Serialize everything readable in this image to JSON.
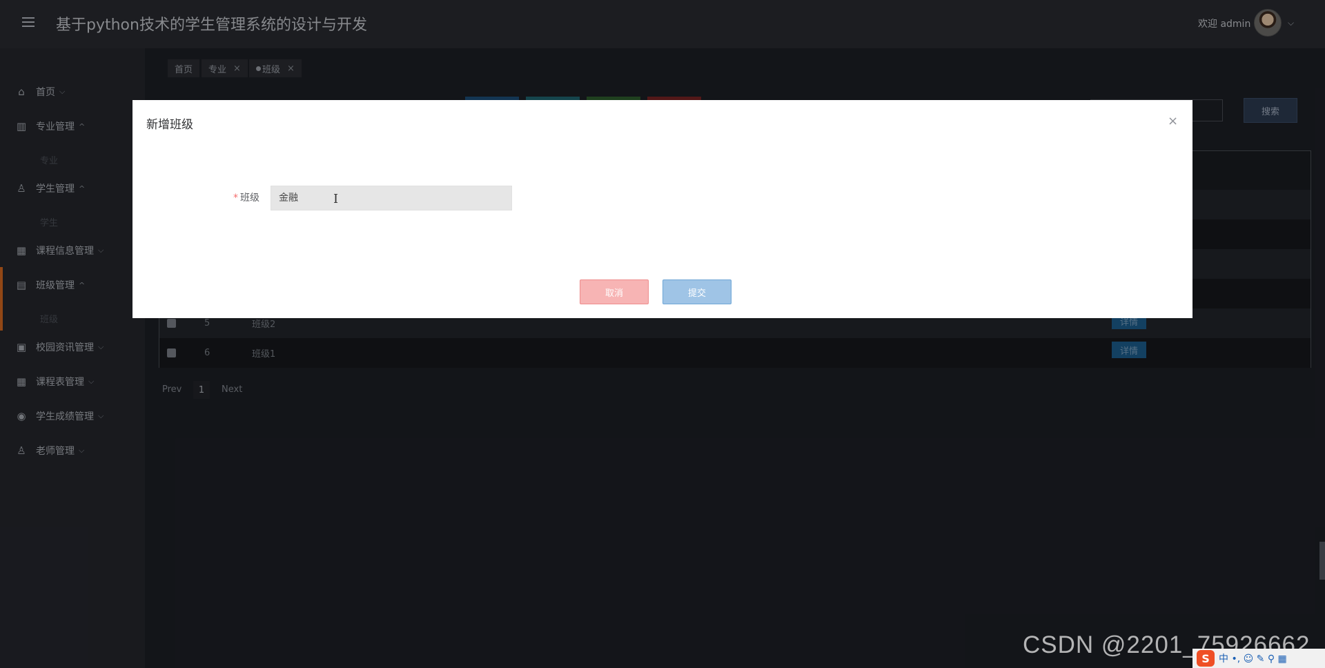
{
  "header": {
    "title": "基于python技术的学生管理系统的设计与开发",
    "welcome": "欢迎 admin",
    "caret": "⌵"
  },
  "sidebar": {
    "items": [
      {
        "label": "首页",
        "caret": "⌵",
        "icon": "home-icon",
        "glyph": "⌂"
      },
      {
        "label": "专业管理",
        "caret": "^",
        "icon": "chart-icon",
        "glyph": "▥",
        "sub": "专业"
      },
      {
        "label": "学生管理",
        "caret": "^",
        "icon": "user-icon",
        "glyph": "♙",
        "sub": "学生"
      },
      {
        "label": "课程信息管理",
        "caret": "⌵",
        "icon": "grid-icon",
        "glyph": "▦"
      },
      {
        "label": "班级管理",
        "caret": "^",
        "icon": "briefcase-icon",
        "glyph": "▤",
        "sub": "班级"
      },
      {
        "label": "校园资讯管理",
        "caret": "⌵",
        "icon": "news-icon",
        "glyph": "▣"
      },
      {
        "label": "课程表管理",
        "caret": "⌵",
        "icon": "schedule-icon",
        "glyph": "▦"
      },
      {
        "label": "学生成绩管理",
        "caret": "⌵",
        "icon": "score-icon",
        "glyph": "◉"
      },
      {
        "label": "老师管理",
        "caret": "⌵",
        "icon": "teacher-icon",
        "glyph": "♙"
      }
    ]
  },
  "tabs": [
    {
      "label": "首页"
    },
    {
      "label": "专业",
      "close": "×"
    },
    {
      "label": "班级",
      "close": "×"
    }
  ],
  "toolbar": {
    "search_label": "搜索",
    "button_colors": [
      "#1d4f7a",
      "#1f6670",
      "#2e5f2f",
      "#7a2424"
    ]
  },
  "table": {
    "rows": [
      {
        "id": "5",
        "name": "班级2",
        "action": "详情"
      },
      {
        "id": "6",
        "name": "班级1",
        "action": "详情"
      }
    ]
  },
  "pager": {
    "prev": "Prev",
    "page": "1",
    "next": "Next"
  },
  "modal": {
    "title": "新增班级",
    "close": "×",
    "field_label": "班级",
    "required_mark": "*",
    "field_value": "金融",
    "cancel": "取消",
    "submit": "提交"
  },
  "watermark": "CSDN @2201_75926662",
  "ime": {
    "logo": "S",
    "text": "中 •, ☺ ✎ ⚲ ▦"
  }
}
